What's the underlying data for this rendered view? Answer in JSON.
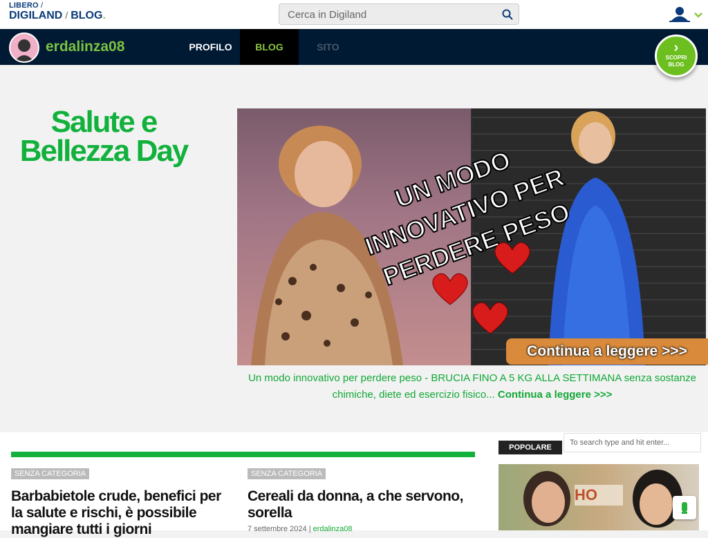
{
  "header": {
    "logo_top": "LIBERO",
    "logo_top_sep": "/",
    "logo_main": "DIGILAND",
    "logo_sep": "/",
    "logo_blog": "BLOG",
    "logo_dot": ".",
    "search_placeholder": "Cerca in Digiland"
  },
  "nav": {
    "username": "erdalinza08",
    "items": [
      {
        "label": "PROFILO"
      },
      {
        "label": "BLOG"
      },
      {
        "label": "SITO"
      }
    ],
    "scopri_line1": "SCOPRI",
    "scopri_line2": "BLOG"
  },
  "hero": {
    "blog_title": "Salute e Bellezza Day",
    "image_overlay": "UN MODO INNOVATIVO PER PERDERE PESO",
    "cta_button": "Continua a leggere >>>",
    "description": "Un modo innovativo per perdere peso - BRUCIA FINO A 5 KG ALLA SETTIMANA senza sostanze chimiche, diete ed esercizio fisico...",
    "read_more": "Continua a leggere >>>"
  },
  "posts": [
    {
      "category": "SENZA CATEGORIA",
      "title": "Barbabietole crude, benefici per la salute e rischi, è possibile mangiare tutti i giorni"
    },
    {
      "category": "SENZA CATEGORIA",
      "title": "Cereali da donna, a che servono, sorella",
      "date": "7 settembre 2024",
      "meta_sep": "|",
      "author": "erdalinza08"
    }
  ],
  "sidebar": {
    "popolare": "POPOLARE",
    "search_placeholder": "To search type and hit enter...",
    "image_text": "HO"
  },
  "colors": {
    "accent_green": "#11b13c",
    "nav_bg": "#001a33",
    "nav_active_text": "#8cc63f"
  }
}
